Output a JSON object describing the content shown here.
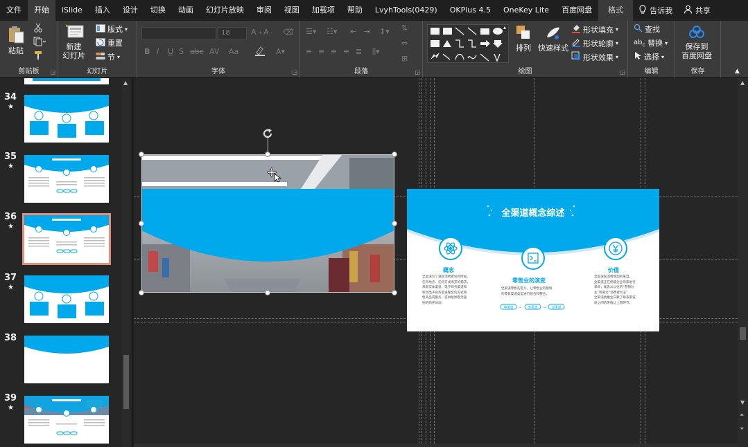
{
  "tabs": [
    {
      "label": "文件",
      "active": false
    },
    {
      "label": "开始",
      "active": true
    },
    {
      "label": "iSlide",
      "active": false
    },
    {
      "label": "插入",
      "active": false
    },
    {
      "label": "设计",
      "active": false
    },
    {
      "label": "切换",
      "active": false
    },
    {
      "label": "动画",
      "active": false
    },
    {
      "label": "幻灯片放映",
      "active": false
    },
    {
      "label": "审阅",
      "active": false
    },
    {
      "label": "视图",
      "active": false
    },
    {
      "label": "加载项",
      "active": false
    },
    {
      "label": "帮助",
      "active": false
    },
    {
      "label": "LvyhTools(0429)",
      "active": false
    },
    {
      "label": "OKPlus 4.5",
      "active": false
    },
    {
      "label": "OneKey Lite",
      "active": false
    },
    {
      "label": "百度网盘",
      "active": false
    },
    {
      "label": "格式",
      "active": false
    }
  ],
  "tell_me": "告诉我",
  "share": "共享",
  "ribbon": {
    "clipboard": {
      "label": "剪贴板",
      "paste": "粘贴"
    },
    "slides": {
      "label": "幻灯片",
      "new_slide": "新建\n幻灯片",
      "layout": "版式",
      "reset": "重置",
      "section": "节"
    },
    "font": {
      "label": "字体",
      "size": "18"
    },
    "paragraph": {
      "label": "段落"
    },
    "drawing": {
      "label": "绘图",
      "arrange": "排列",
      "quick_styles": "快速样式",
      "fill": "形状填充",
      "outline": "形状轮廓",
      "effects": "形状效果"
    },
    "editing": {
      "label": "编辑",
      "find": "查找",
      "replace": "替换",
      "select": "选择"
    },
    "save": {
      "label": "保存",
      "save_baidu": "保存到\n百度网盘"
    }
  },
  "slides": [
    {
      "number": "34",
      "star": "★"
    },
    {
      "number": "35",
      "star": "★"
    },
    {
      "number": "36",
      "star": "★",
      "selected": true
    },
    {
      "number": "37",
      "star": "★"
    },
    {
      "number": "38",
      "star": ""
    },
    {
      "number": "39",
      "star": "★"
    }
  ],
  "main_slide": {
    "title": "全渠道概念综述",
    "cols": [
      {
        "icon": "atom-icon",
        "heading": "概念",
        "lines": [
          "全渠道为了满足消费者任何时候、",
          "任何地点、任何方式购买的需求，",
          "采取实体渠道、电子商务渠道和",
          "移动电子商务渠道整合的方式销",
          "售商品或服务，提供给顾客无差",
          "别的购买体验。"
        ]
      },
      {
        "icon": "terminal-icon",
        "heading": "零售业的演变",
        "lines": [
          "全渠道零售的定义，让零售业有能够",
          "的零售渠道类型进行组合和整合。"
        ],
        "chips": [
          "单渠道",
          "多渠道",
          "全渠道"
        ]
      },
      {
        "icon": "yen-icon",
        "heading": "价值",
        "lines": [
          "全渠道既消费增加的来自。",
          "全渠道正在倒逼企业商家进行",
          "革命，尾去从以往的“营销为",
          "主”转变为“消费者为王”",
          "全渠道助推生日聚了联系渠道",
          "商之间的矛盾让上游环节。"
        ]
      }
    ]
  },
  "colors": {
    "accent_blue": "#00a8ec",
    "selected_outline": "#e0907a"
  }
}
